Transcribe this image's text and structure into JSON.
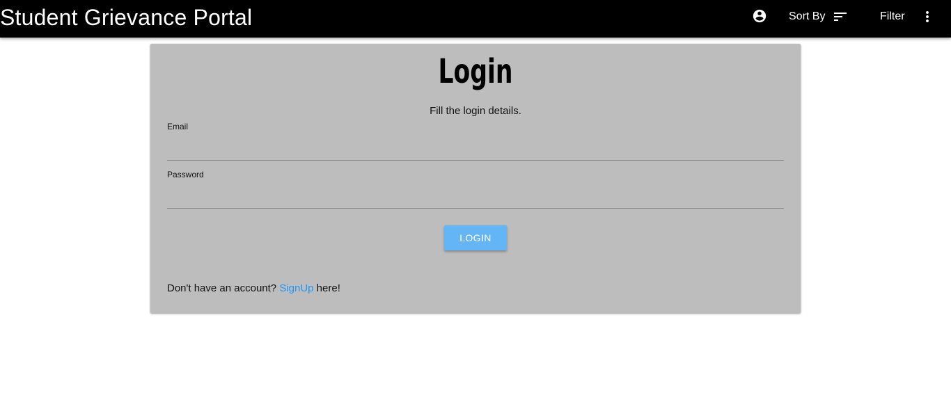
{
  "header": {
    "title": "Student Grievance Portal",
    "account_icon": "account-circle-icon",
    "sort_label": "Sort By",
    "sort_icon": "sort-icon",
    "filter_label": "Filter",
    "more_icon": "more-vert-icon"
  },
  "login": {
    "title": "Login",
    "subtitle": "Fill the login details.",
    "email_label": "Email",
    "email_value": "",
    "password_label": "Password",
    "password_value": "",
    "button_label": "LOGIN",
    "signup_prefix": "Don't have an account? ",
    "signup_link": "SignUp",
    "signup_suffix": " here!"
  },
  "colors": {
    "appbar": "#000000",
    "card": "#bdbdbd",
    "button": "#64b5f6",
    "link": "#2196f3"
  }
}
